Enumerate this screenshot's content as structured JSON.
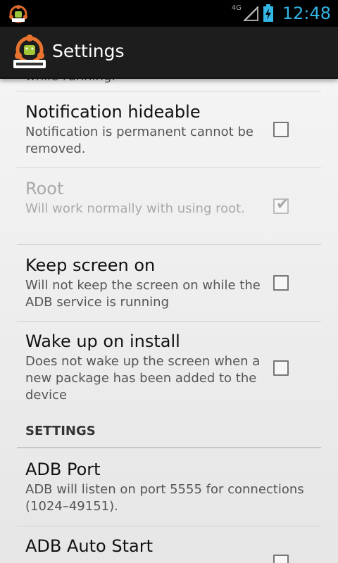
{
  "status_bar": {
    "network": "4G",
    "time": "12:48"
  },
  "action_bar": {
    "title": "Settings"
  },
  "partial_item": {
    "summary": "while running."
  },
  "items": [
    {
      "title": "Notification hideable",
      "summary": "Notification is permanent cannot be removed.",
      "checked": false,
      "enabled": true
    },
    {
      "title": "Root",
      "summary": "Will work normally with using root.",
      "checked": true,
      "enabled": false
    },
    {
      "title": "Keep screen on",
      "summary": "Will not keep the screen on while the ADB service is running",
      "checked": false,
      "enabled": true
    },
    {
      "title": "Wake up on install",
      "summary": "Does not wake up the screen when a new package has been added to the device",
      "checked": false,
      "enabled": true
    }
  ],
  "section": {
    "header": "SETTINGS"
  },
  "settings_items": [
    {
      "title": "ADB Port",
      "summary": "ADB will listen on port 5555 for connections (1024–49151)."
    },
    {
      "title": "ADB Auto Start",
      "checked": false
    }
  ],
  "colors": {
    "accent": "#33b5e5",
    "actionbar": "#1d1d1d",
    "background": "#ececec"
  }
}
